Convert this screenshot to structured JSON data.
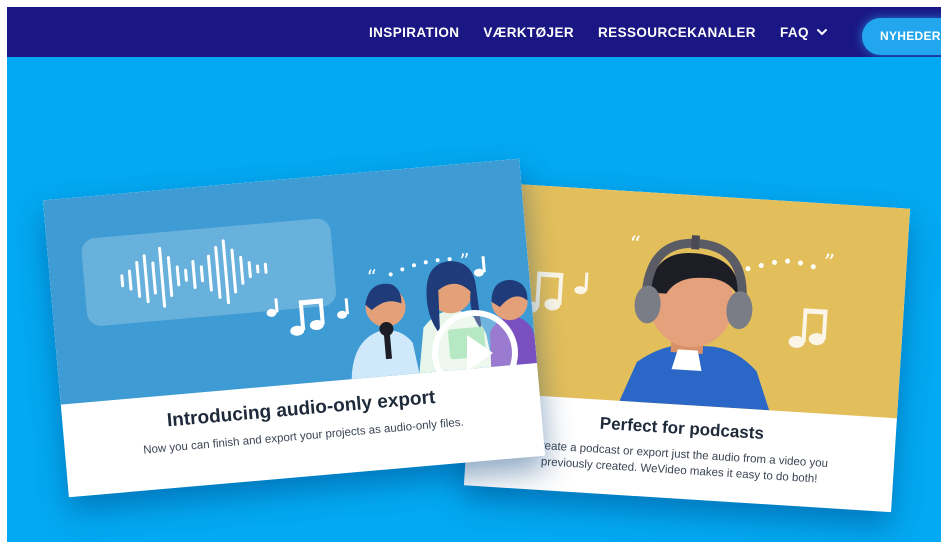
{
  "nav": {
    "items": [
      {
        "label": "INSPIRATION"
      },
      {
        "label": "VÆRKTØJER"
      },
      {
        "label": "RESSOURCEKANALER"
      },
      {
        "label": "FAQ"
      }
    ],
    "cta_label": "NYHEDER,"
  },
  "cards": {
    "left": {
      "title": "Introducing audio-only export",
      "description": "Now you can finish and export your projects as audio-only files."
    },
    "right": {
      "title": "Perfect for podcasts",
      "description": "Create a podcast or export just the audio from a video you previously created. WeVideo makes it easy to do both!"
    }
  },
  "colors": {
    "nav_bg": "#1a1784",
    "hero_bg": "#03a9f2",
    "cta_bg": "#22a6ee",
    "left_card_illustration": "#3e9bd3",
    "right_card_illustration": "#e3bf5c"
  },
  "icons": [
    "chevron-down-icon",
    "play-icon",
    "headphones-icon",
    "music-note-icon",
    "waveform-icon"
  ]
}
